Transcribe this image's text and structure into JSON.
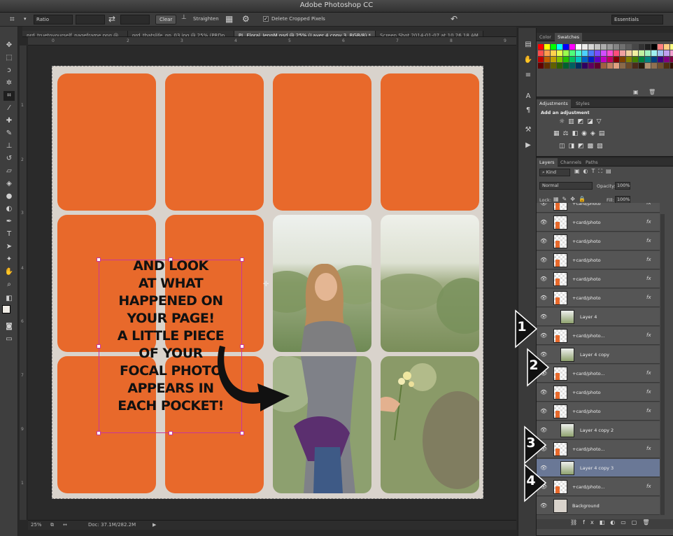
{
  "window": {
    "title": "Adobe Photoshop CC"
  },
  "options": {
    "ratio_label": "Ratio",
    "clear_label": "Clear",
    "straighten_label": "Straighten",
    "delete_cropped_label": "Delete Cropped Pixels",
    "workspace_label": "Essentials"
  },
  "tabs": [
    {
      "label": "prd_truetoyourself_pageframe.png @..."
    },
    {
      "label": "prd_thatslife_pp_03.jpg @ 25% (PRDp..."
    },
    {
      "label": "PL_Floral_JennM.psd @ 25% (Layer 4 copy 3, RGB/8) *"
    },
    {
      "label": "Screen Shot 2014-01-07 at 10.26.18 AM"
    }
  ],
  "canvas": {
    "overlay_lines": [
      "AND LOOK",
      "AT WHAT HAPPENED ON",
      "YOUR PAGE!",
      "A LITTLE PIECE",
      "OF YOUR",
      "FOCAL PHOTO",
      "APPEARS IN",
      "EACH POCKET!"
    ],
    "pocket_color": "#e8692b"
  },
  "status": {
    "zoom": "25%",
    "doc": "Doc: 37.1M/282.2M"
  },
  "panels": {
    "color_tabs": [
      "Color",
      "Swatches"
    ],
    "adj_tabs": [
      "Adjustments",
      "Styles"
    ],
    "adj_title": "Add an adjustment",
    "layer_tabs": [
      "Layers",
      "Channels",
      "Paths"
    ],
    "kind_label": "Kind",
    "blend_mode": "Normal",
    "opacity_label": "Opacity:",
    "opacity_value": "100%",
    "lock_label": "Lock:",
    "fill_label": "Fill:",
    "fill_value": "100%"
  },
  "layers": [
    {
      "name": "+card/photo",
      "fx": "fx",
      "style": "card"
    },
    {
      "name": "+card/photo",
      "fx": "fx",
      "style": "card"
    },
    {
      "name": "+card/photo",
      "fx": "fx",
      "style": "card"
    },
    {
      "name": "+card/photo",
      "fx": "fx",
      "style": "card"
    },
    {
      "name": "+card/photo",
      "fx": "fx",
      "style": "card"
    },
    {
      "name": "+card/photo",
      "fx": "fx",
      "style": "card"
    },
    {
      "name": "Layer 4",
      "fx": "",
      "style": "clip"
    },
    {
      "name": "+card/photo...",
      "fx": "fx",
      "style": "card"
    },
    {
      "name": "Layer 4 copy",
      "fx": "",
      "style": "clip"
    },
    {
      "name": "+card/photo...",
      "fx": "fx",
      "style": "card"
    },
    {
      "name": "+card/photo",
      "fx": "fx",
      "style": "card"
    },
    {
      "name": "+card/photo",
      "fx": "fx",
      "style": "card"
    },
    {
      "name": "Layer 4 copy 2",
      "fx": "",
      "style": "clip"
    },
    {
      "name": "+card/photo...",
      "fx": "fx",
      "style": "card"
    },
    {
      "name": "Layer 4 copy 3",
      "fx": "",
      "style": "clip",
      "selected": true
    },
    {
      "name": "+card/photo...",
      "fx": "fx",
      "style": "card"
    },
    {
      "name": "Background",
      "fx": "",
      "style": "bg"
    }
  ],
  "callouts": [
    "1",
    "2",
    "3",
    "4"
  ],
  "swatch_colors": [
    "#ff0000",
    "#ffff00",
    "#00ff00",
    "#00ffff",
    "#0000ff",
    "#ff00ff",
    "#ffffff",
    "#ebebeb",
    "#d6d6d6",
    "#c2c2c2",
    "#adadad",
    "#999999",
    "#858585",
    "#707070",
    "#5c5c5c",
    "#474747",
    "#333333",
    "#1f1f1f",
    "#000000",
    "#ff8080",
    "#ffcc80",
    "#ffff80"
  ]
}
